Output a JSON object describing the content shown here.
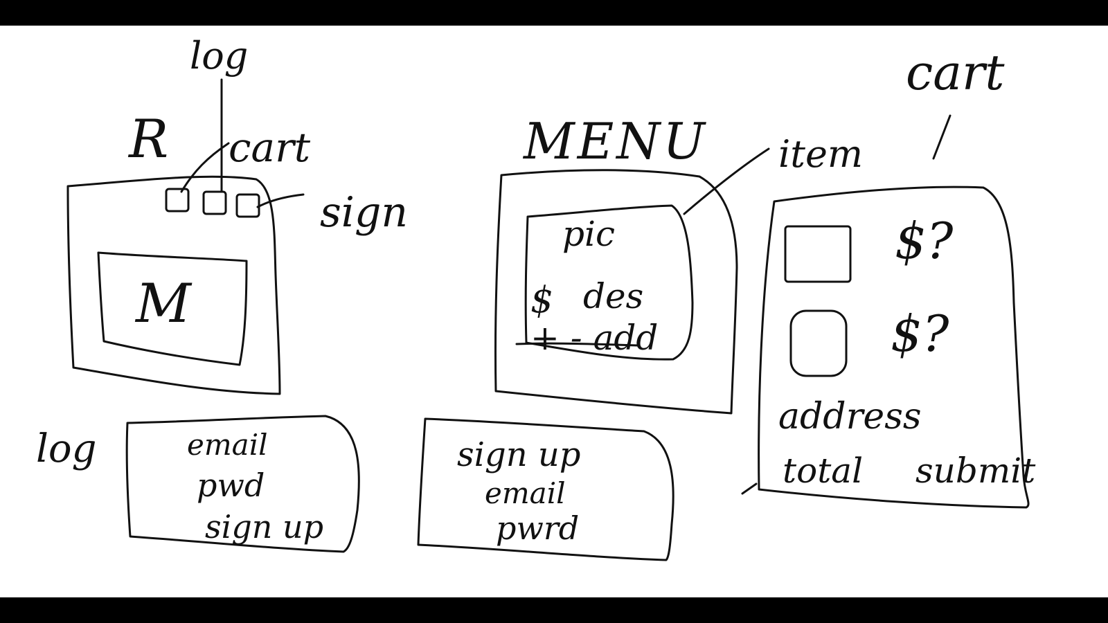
{
  "colors": {
    "letterbox": "#000000",
    "paper": "#ffffff",
    "ink": "#111111"
  },
  "home_wireframe": {
    "logo_label": "R",
    "cart_label": "cart",
    "log_label": "log",
    "sign_label": "sign",
    "hero_label": "M"
  },
  "menu_wireframe": {
    "title": "MENU",
    "item_callout": "item",
    "item_card": {
      "pic_label": "pic",
      "price_label": "$",
      "desc_label": "des",
      "controls_label": "+ - add"
    }
  },
  "cart_wireframe": {
    "title": "cart",
    "rows": [
      {
        "price": "$?"
      },
      {
        "price": "$?"
      }
    ],
    "address_label": "address",
    "total_label": "total",
    "submit_label": "submit"
  },
  "login_wireframe": {
    "side_label": "log",
    "email_label": "email",
    "password_label": "pwd",
    "signup_link_label": "sign up"
  },
  "signup_wireframe": {
    "title": "sign up",
    "email_label": "email",
    "password_label": "pwrd"
  }
}
